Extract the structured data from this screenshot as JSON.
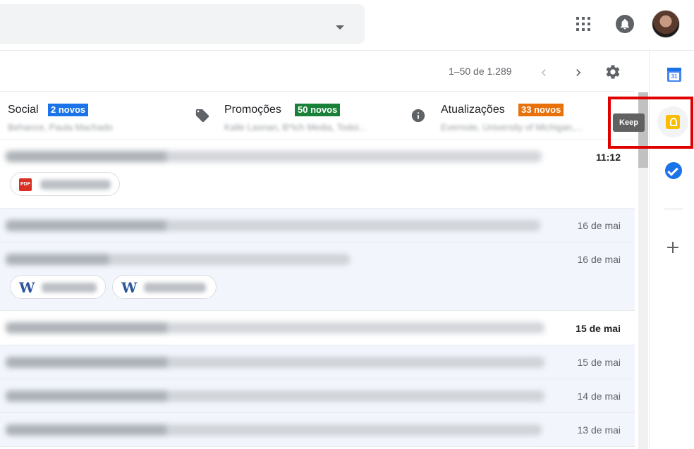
{
  "header": {
    "icons": [
      "apps-grid-icon",
      "notifications-icon",
      "avatar"
    ]
  },
  "toolbar": {
    "pager_text": "1–50 de 1.289"
  },
  "tabs": [
    {
      "title": "Social",
      "badge": "2 novos",
      "badge_color": "#1a73e8",
      "subtitle": "Behance, Paula Machado"
    },
    {
      "title": "Promoções",
      "badge": "50 novos",
      "badge_color": "#188038",
      "subtitle": "Kalle Lasnan, B*tch Media, Todoi..."
    },
    {
      "title": "Atualizações",
      "badge": "33 novos",
      "badge_color": "#e8710a",
      "subtitle": "Evernote, University of Michigan,..."
    }
  ],
  "side_panel": {
    "calendar_number": "31",
    "keep_tooltip": "Keep",
    "highlight_color": "#e00000"
  },
  "mail_rows": [
    {
      "date": "11:12",
      "unread": true,
      "attachments": [
        "pdf"
      ]
    },
    {
      "date": "16 de mai",
      "unread": false,
      "attachments": []
    },
    {
      "date": "16 de mai",
      "unread": false,
      "attachments": [
        "word",
        "word"
      ]
    },
    {
      "date": "15 de mai",
      "unread": true,
      "attachments": []
    },
    {
      "date": "15 de mai",
      "unread": false,
      "attachments": []
    },
    {
      "date": "14 de mai",
      "unread": false,
      "attachments": []
    },
    {
      "date": "13 de mai",
      "unread": false,
      "attachments": []
    }
  ],
  "labels": {
    "pdf": "PDF",
    "word": "W"
  }
}
